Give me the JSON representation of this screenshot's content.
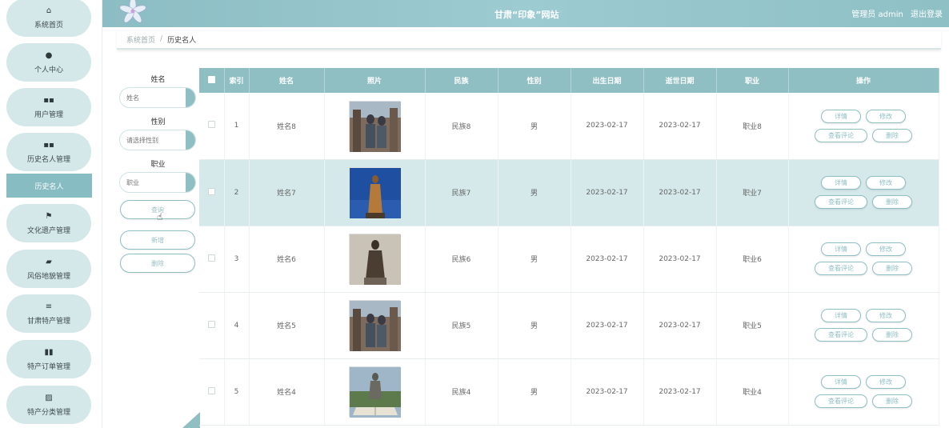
{
  "header": {
    "title": "甘肃“印象”网站",
    "user": "管理员 admin",
    "logout": "退出登录"
  },
  "breadcrumb": {
    "home": "系统首页",
    "sep": "/",
    "current": "历史名人"
  },
  "sidebar": {
    "items": [
      {
        "label": "系统首页",
        "icon": "home-icon",
        "glyph": "⌂"
      },
      {
        "label": "个人中心",
        "icon": "user-icon",
        "glyph": "●"
      },
      {
        "label": "用户管理",
        "icon": "grid-icon",
        "glyph": "▪▪"
      },
      {
        "label": "历史名人管理",
        "icon": "grid-icon",
        "glyph": "▪▪"
      },
      {
        "label": "文化遗产管理",
        "icon": "flag-icon",
        "glyph": "⚑"
      },
      {
        "label": "风俗地貌管理",
        "icon": "camera-icon",
        "glyph": "▰"
      },
      {
        "label": "甘肃特产管理",
        "icon": "list-icon",
        "glyph": "≡"
      },
      {
        "label": "特产订单管理",
        "icon": "order-icon",
        "glyph": "▮▮"
      },
      {
        "label": "特产分类管理",
        "icon": "picture-icon",
        "glyph": "▨"
      }
    ],
    "active_sub": "历史名人"
  },
  "search": {
    "name_label": "姓名",
    "name_placeholder": "姓名",
    "gender_label": "性别",
    "gender_placeholder": "请选择性别",
    "job_label": "职业",
    "job_placeholder": "职业",
    "query_btn": "查询",
    "add_btn": "新增",
    "delete_btn": "删除"
  },
  "table": {
    "headers": [
      "索引",
      "姓名",
      "照片",
      "民族",
      "性别",
      "出生日期",
      "逝世日期",
      "职业",
      "操作"
    ],
    "rows": [
      {
        "index": "1",
        "name": "姓名8",
        "nation": "民族8",
        "gender": "男",
        "birth": "2023-02-17",
        "death": "2023-02-17",
        "job": "职业8",
        "photo": "photo-statues-pair"
      },
      {
        "index": "2",
        "name": "姓名7",
        "nation": "民族7",
        "gender": "男",
        "birth": "2023-02-17",
        "death": "2023-02-17",
        "job": "职业7",
        "photo": "photo-bronze-statue-blue-sky"
      },
      {
        "index": "3",
        "name": "姓名6",
        "nation": "民族6",
        "gender": "男",
        "birth": "2023-02-17",
        "death": "2023-02-17",
        "job": "职业6",
        "photo": "photo-dark-statue"
      },
      {
        "index": "4",
        "name": "姓名5",
        "nation": "民族5",
        "gender": "男",
        "birth": "2023-02-17",
        "death": "2023-02-17",
        "job": "职业5",
        "photo": "photo-statues-pair"
      },
      {
        "index": "5",
        "name": "姓名4",
        "nation": "民族4",
        "gender": "男",
        "birth": "2023-02-17",
        "death": "2023-02-17",
        "job": "职业4",
        "photo": "photo-statue-with-book"
      }
    ],
    "ops": {
      "detail": "详情",
      "edit": "修改",
      "comments": "查看评论",
      "delete": "删除"
    }
  },
  "colors": {
    "accent": "#8fbfc3",
    "sidebar_pill": "#d4e8ea",
    "row_alt": "#d5e8ea"
  }
}
